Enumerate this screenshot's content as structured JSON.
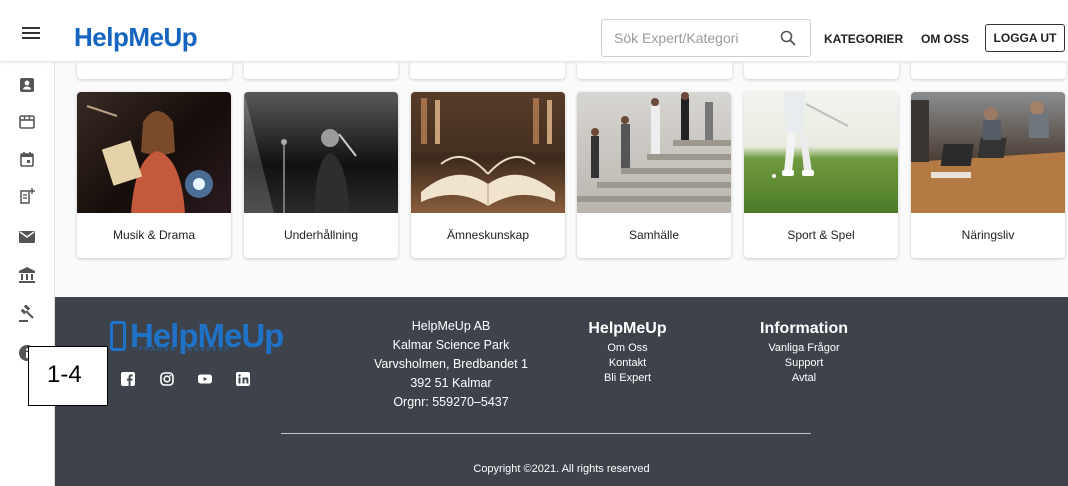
{
  "header": {
    "brand": "HelpMeUp",
    "search_placeholder": "Sök Expert/Kategori",
    "nav": [
      "KATEGORIER",
      "OM OSS"
    ],
    "logout": "LOGGA UT"
  },
  "sidebar": {
    "icons": [
      "profile-icon",
      "store-icon",
      "calendar-icon",
      "post-add-icon",
      "mail-icon",
      "bank-icon",
      "gavel-icon",
      "info-icon"
    ]
  },
  "categories": [
    {
      "label": "Musik & Drama",
      "image": "singer-on-stage"
    },
    {
      "label": "Underhållning",
      "image": "band-concert"
    },
    {
      "label": "Ämneskunskap",
      "image": "open-book-library"
    },
    {
      "label": "Samhälle",
      "image": "people-on-stairs"
    },
    {
      "label": "Sport & Spel",
      "image": "golfer"
    },
    {
      "label": "Näringsliv",
      "image": "office-meeting"
    }
  ],
  "footer": {
    "logo": "HelpMeUp",
    "tagline": "FRÅGOR · KUNSKAP",
    "address": [
      "HelpMeUp AB",
      "Kalmar Science Park",
      "Varvsholmen, Bredbandet 1",
      "392 51 Kalmar",
      "Orgnr: 559270–5437"
    ],
    "col1": {
      "heading": "HelpMeUp",
      "links": [
        "Om Oss",
        "Kontakt",
        "Bli Expert"
      ]
    },
    "col2": {
      "heading": "Information",
      "links": [
        "Vanliga Frågor",
        "Support",
        "Avtal"
      ]
    },
    "socials": [
      "facebook-icon",
      "instagram-icon",
      "youtube-icon",
      "linkedin-icon"
    ],
    "copyright": "Copyright ©2021. All rights reserved"
  },
  "annotation": "1-4",
  "colors": {
    "brand": "#1565c0",
    "footer_bg": "#3e424b"
  }
}
